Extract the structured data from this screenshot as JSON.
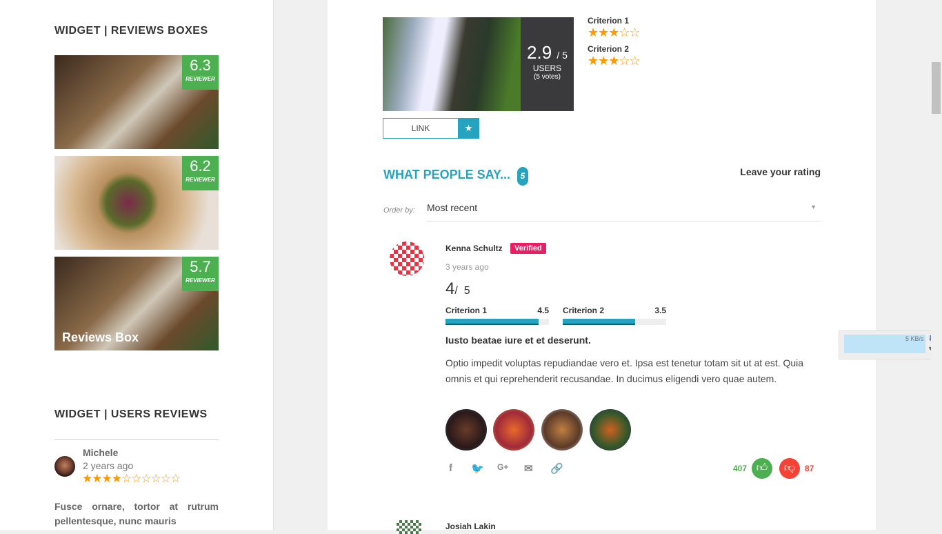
{
  "sidebar": {
    "reviews_boxes_title": "WIDGET | REVIEWS BOXES",
    "boxes": [
      {
        "score": "6.3",
        "label": "REVIEWER"
      },
      {
        "score": "6.2",
        "label": "REVIEWER"
      },
      {
        "score": "5.7",
        "label": "REVIEWER",
        "caption": "Reviews Box"
      }
    ],
    "users_reviews_title": "WIDGET | USERS REVIEWS",
    "user_review": {
      "name": "Michele",
      "time": "2 years ago",
      "rating": 4.5,
      "max": 10,
      "text": "Fusce ornare, tortor at rutrum pellentesque, nunc mauris"
    }
  },
  "summary": {
    "score": "2.9",
    "max": "/ 5",
    "label": "USERS",
    "votes": "(5 votes)",
    "criteria": [
      {
        "name": "Criterion 1",
        "stars": 3,
        "max": 5
      },
      {
        "name": "Criterion 2",
        "stars": 3,
        "max": 5
      }
    ],
    "link_label": "LINK"
  },
  "reviews_section": {
    "title": "WHAT PEOPLE SAY...",
    "count": "5",
    "leave_rating": "Leave your rating",
    "order_label": "Order by:",
    "order_value": "Most recent"
  },
  "review": {
    "name": "Kenna Schultz",
    "badge": "Verified",
    "time": "3 years ago",
    "score": "4",
    "max": "/  5",
    "criteria": [
      {
        "name": "Criterion 1",
        "value": "4.5",
        "pct": 90
      },
      {
        "name": "Criterion 2",
        "value": "3.5",
        "pct": 70
      }
    ],
    "title": "Iusto beatae iure et et deserunt.",
    "body": "Optio impedit voluptas repudiandae vero et. Ipsa est tenetur totam sit ut at est. Quia omnis et qui reprehenderit recusandae. In ducimus eligendi vero quae autem.",
    "likes": "407",
    "dislikes": "87"
  },
  "next_review": {
    "name": "Josiah Lakin"
  },
  "download_widget": {
    "speed": "5 KB/s"
  },
  "colors": {
    "accent": "#26a3bf",
    "green": "#4caf50",
    "red": "#f44336",
    "star": "#ff9900",
    "verified": "#e91e63"
  }
}
